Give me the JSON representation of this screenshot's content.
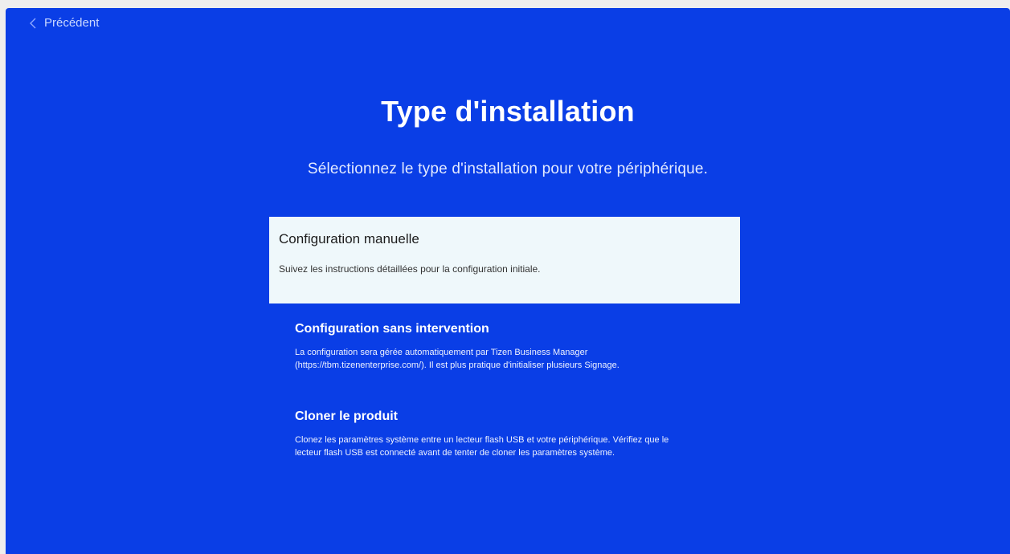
{
  "nav": {
    "back_label": "Précédent",
    "back_icon": "chevron-left-icon"
  },
  "header": {
    "title": "Type d'installation",
    "subtitle": "Sélectionnez le type d'installation pour votre périphérique."
  },
  "options": [
    {
      "title": "Configuration manuelle",
      "description": "Suivez les instructions détaillées pour la configuration initiale.",
      "selected": true
    },
    {
      "title": "Configuration sans intervention",
      "description": "La configuration sera gérée automatiquement par Tizen Business Manager (https://tbm.tizenenterprise.com/). Il est plus pratique d'initialiser plusieurs Signage.",
      "selected": false
    },
    {
      "title": "Cloner le produit",
      "description": "Clonez les paramètres système entre un lecteur flash USB et votre périphérique. Vérifiez que le lecteur flash USB est connecté avant de tenter de cloner les paramètres système.",
      "selected": false
    }
  ],
  "colors": {
    "background": "#0a3ee6",
    "selected_background": "#eff8fb"
  }
}
